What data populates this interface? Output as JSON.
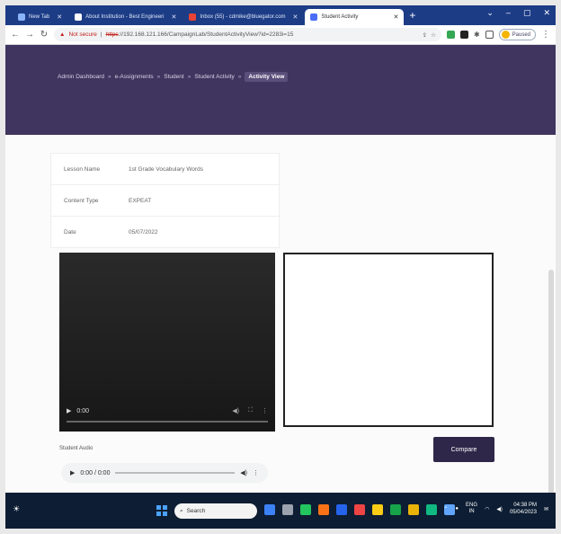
{
  "browser": {
    "tabs": [
      {
        "title": "New Tab",
        "color": "#8ab4f8",
        "active": false
      },
      {
        "title": "About Institution - Best Engineeri",
        "color": "#ffffff",
        "active": false
      },
      {
        "title": "Inbox (55) - cdmike@bluegator.com",
        "color": "#ea4335",
        "active": false
      },
      {
        "title": "Student Activity",
        "color": "#4a6cf7",
        "active": true
      }
    ],
    "address": {
      "security_label": "Not secure",
      "scheme": "https",
      "url_rest": "://192.168.121.166/CampaignLab/StudentActivityView?id=2283i=15"
    },
    "profile_label": "Paused"
  },
  "app": {
    "breadcrumb": [
      "Admin Dashboard",
      "e-Assignments",
      "Student",
      "Student Activity",
      "Activity View"
    ],
    "info": {
      "lesson_name_label": "Lesson Name",
      "lesson_name_value": "1st Grade Vocabulary Words",
      "content_type_label": "Content Type",
      "content_type_value": "EXPEAT",
      "date_label": "Date",
      "date_value": "05/07/2022"
    },
    "video": {
      "time": "0:00"
    },
    "student_audio_label": "Student Audio",
    "audio": {
      "time": "0:00 / 0:00"
    },
    "compare_label": "Compare"
  },
  "taskbar": {
    "search_placeholder": "Search",
    "lang_top": "ENG",
    "lang_bottom": "IN",
    "time": "04:38 PM",
    "date": "05/04/2023",
    "icon_colors": [
      "#3b82f6",
      "#9ca3af",
      "#22c55e",
      "#f97316",
      "#2563eb",
      "#ef4444",
      "#facc15",
      "#16a34a",
      "#eab308",
      "#10b981",
      "#60a5fa"
    ]
  }
}
